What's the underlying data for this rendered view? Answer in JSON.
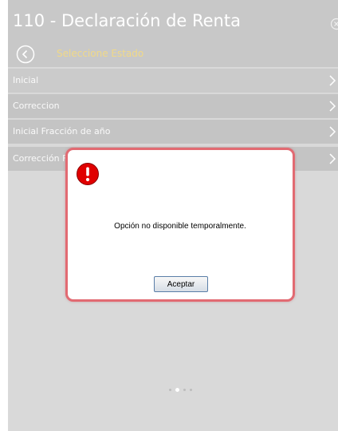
{
  "header": {
    "title": "110 - Declaración de Renta"
  },
  "subheader": {
    "title": "Seleccione Estado"
  },
  "menu": {
    "items": [
      {
        "label": "Inicial"
      },
      {
        "label": "Correccion"
      },
      {
        "label": "Inicial Fracción de año"
      },
      {
        "label": "Corrección Fracción de año"
      }
    ]
  },
  "dialog": {
    "message": "Opción no disponible temporalmente.",
    "ok_label": "Aceptar"
  },
  "colors": {
    "accent": "#f1d987",
    "dialog_border": "#e26a72",
    "alert_red": "#e00000"
  }
}
